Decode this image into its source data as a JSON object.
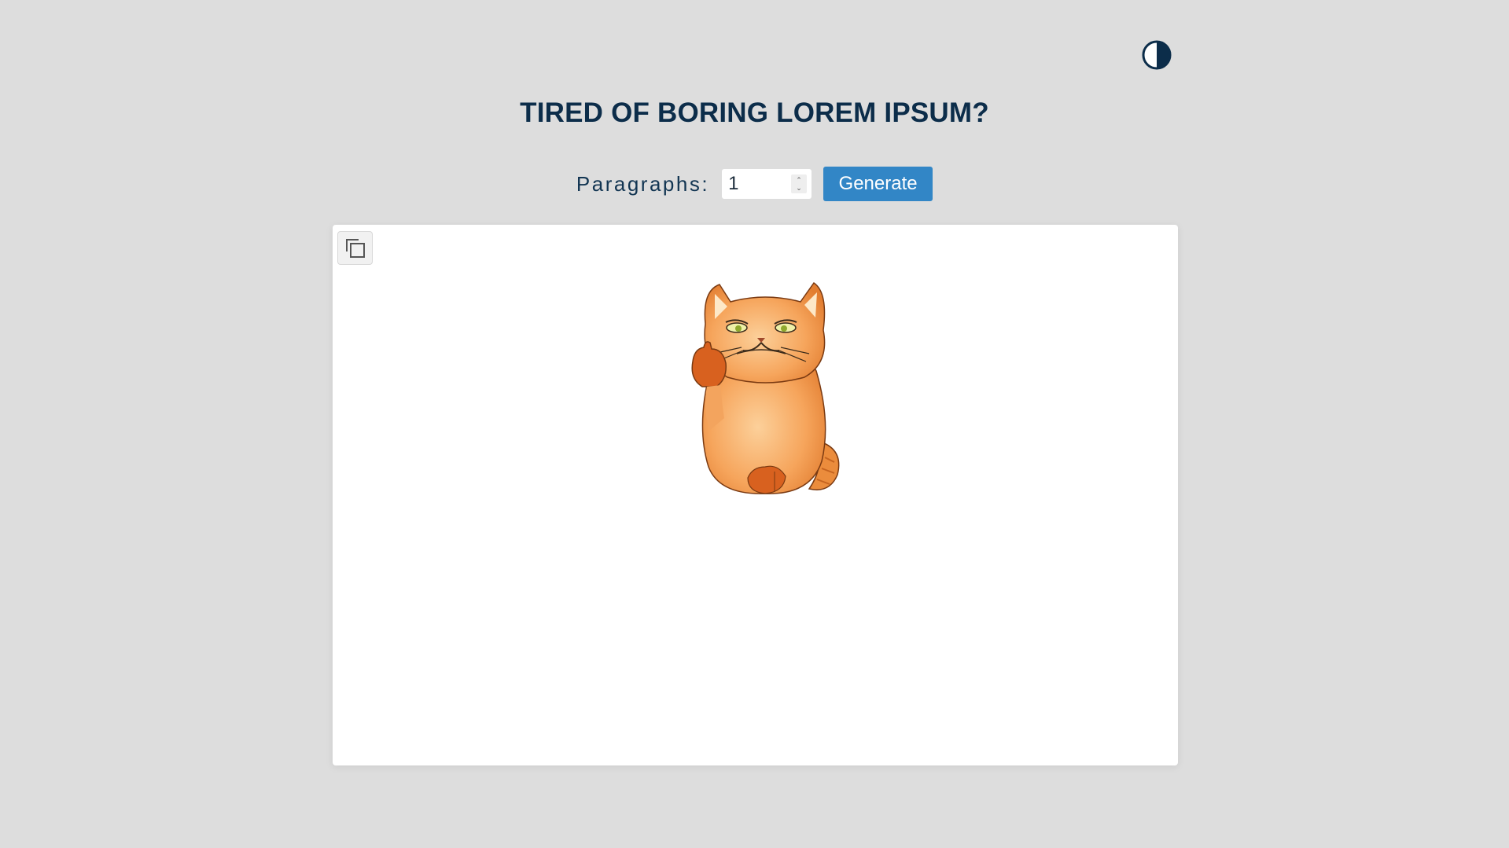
{
  "header": {
    "theme_toggle_icon": "contrast-icon",
    "title": "TIRED OF BORING LOREM IPSUM?"
  },
  "controls": {
    "paragraphs_label": "Paragraphs:",
    "paragraphs_value": "1",
    "generate_label": "Generate"
  },
  "output": {
    "copy_icon": "copy-icon",
    "image": "grumpy-orange-cat-thumbs-up"
  },
  "colors": {
    "background": "#dddddd",
    "title": "#0c2d4a",
    "accent": "#3286c6",
    "panel": "#ffffff"
  }
}
